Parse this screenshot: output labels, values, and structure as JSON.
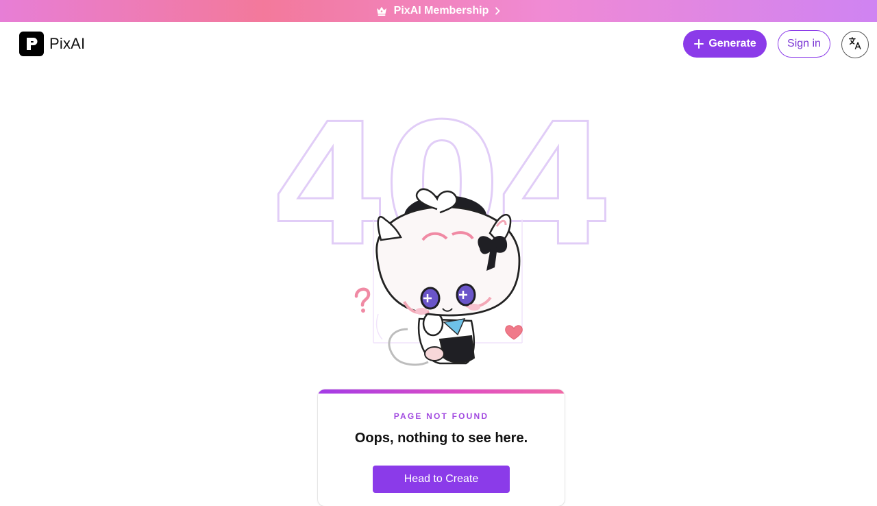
{
  "banner": {
    "label": "PixAI Membership",
    "icon": "crown-icon",
    "gradient": [
      "#e77ed6",
      "#f3799b",
      "#cf83f2"
    ]
  },
  "header": {
    "logo_text": "PixAI",
    "generate_label": "Generate",
    "signin_label": "Sign in",
    "language_icon": "translate-icon"
  },
  "hero": {
    "big_text": "404"
  },
  "card": {
    "kicker": "PAGE NOT FOUND",
    "title": "Oops, nothing to see here.",
    "button_label": "Head to Create"
  },
  "colors": {
    "accent": "#8b3be9",
    "kicker": "#a24be0",
    "outline": "#e1cdf7"
  }
}
